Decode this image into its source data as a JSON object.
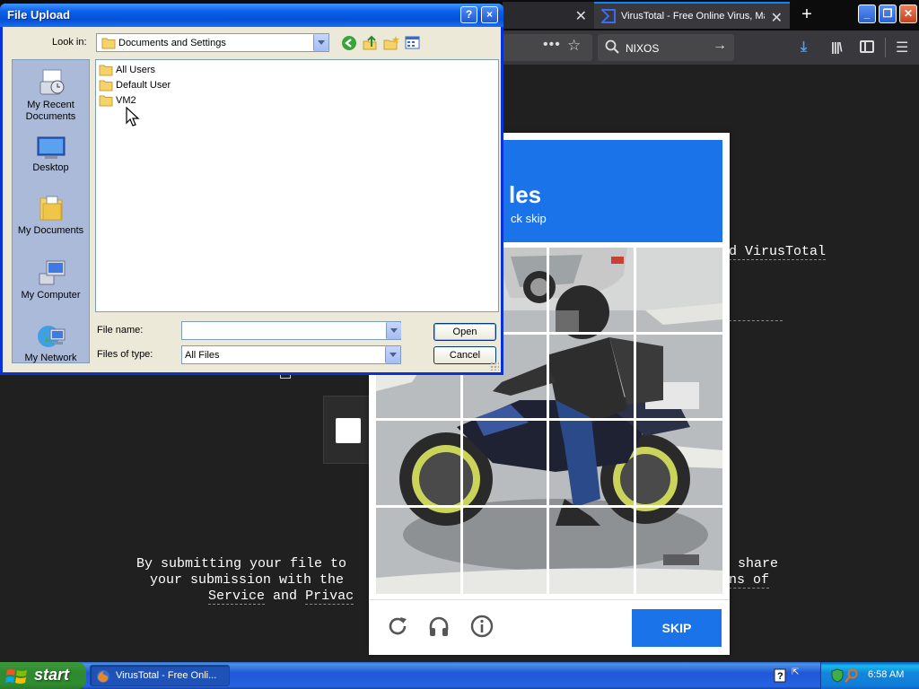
{
  "browser": {
    "tabs": [
      {
        "label": "",
        "active": false
      },
      {
        "label": "VirusTotal - Free Online Virus, Mal",
        "active": true
      }
    ],
    "new_tab": "+",
    "search_text": "NIXOS",
    "accent_color": "#0a84ff"
  },
  "page_background": {
    "text_virustotal": "d VirusTotal",
    "line1_left": "By submitting your file to",
    "line1_right": "share",
    "line2_left": "your submission with the",
    "line2_right": "ns of",
    "line3_left": "Service",
    "line3_and": "and",
    "line3_right": "Privac"
  },
  "captcha": {
    "title": "les",
    "subtitle": "ck skip",
    "skip_label": "SKIP",
    "brand_color": "#1a73e8",
    "grid": "4x4"
  },
  "file_dialog": {
    "title": "File Upload",
    "help": "?",
    "close": "×",
    "look_in_label": "Look in:",
    "look_in_value": "Documents and Settings",
    "places": [
      {
        "label": "My Recent Documents"
      },
      {
        "label": "Desktop"
      },
      {
        "label": "My Documents"
      },
      {
        "label": "My Computer"
      },
      {
        "label": "My Network"
      }
    ],
    "files": [
      "All Users",
      "Default User",
      "VM2"
    ],
    "file_name_label": "File name:",
    "file_name_value": "",
    "files_of_type_label": "Files of type:",
    "files_of_type_value": "All Files",
    "open_label": "Open",
    "cancel_label": "Cancel"
  },
  "taskbar": {
    "start_label": "start",
    "items": [
      {
        "label": "VirusTotal - Free Onli..."
      }
    ],
    "clock": "6:58 AM"
  }
}
